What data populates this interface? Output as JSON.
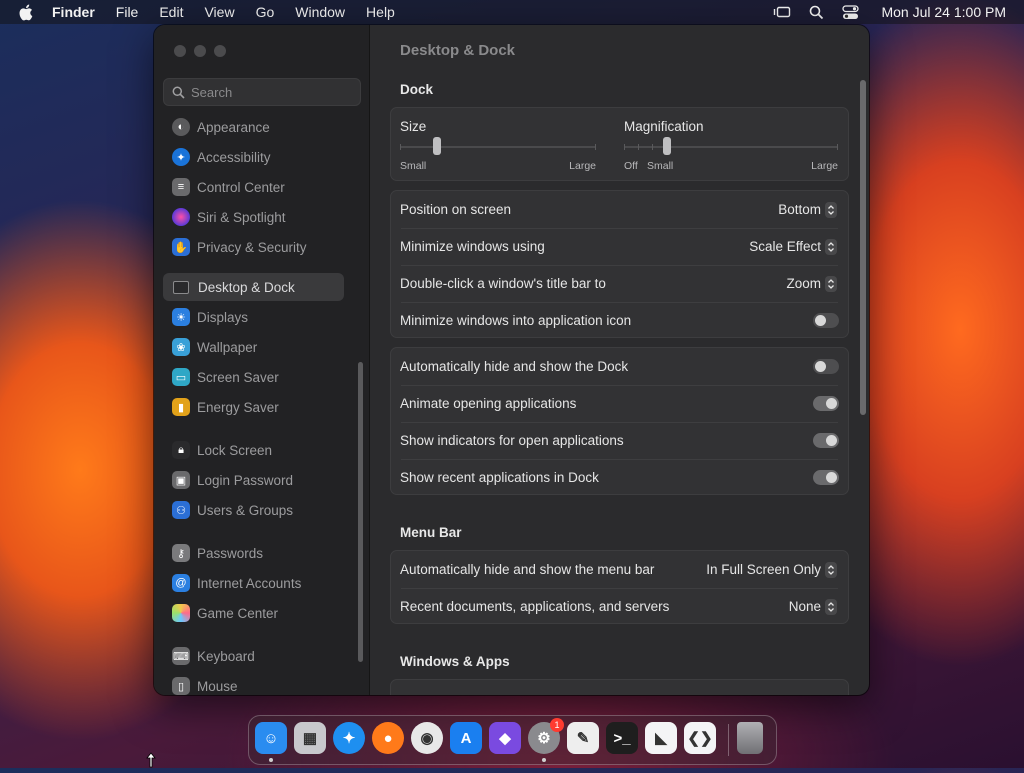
{
  "menubar": {
    "app_name": "Finder",
    "items": [
      "File",
      "Edit",
      "View",
      "Go",
      "Window",
      "Help"
    ],
    "clock": "Mon Jul 24  1:00 PM"
  },
  "sidebar": {
    "search_placeholder": "Search",
    "items": [
      {
        "label": "Appearance",
        "icon": "appearance-icon",
        "color": "#5a5a5c"
      },
      {
        "label": "Accessibility",
        "icon": "accessibility-icon",
        "color": "#1a73d9"
      },
      {
        "label": "Control Center",
        "icon": "control-center-icon",
        "color": "#6a6a6c"
      },
      {
        "label": "Siri & Spotlight",
        "icon": "siri-icon",
        "color": "#b03ad6"
      },
      {
        "label": "Privacy & Security",
        "icon": "hand-icon",
        "color": "#2b6fd6"
      },
      {
        "label": "Desktop & Dock",
        "icon": "dock-icon",
        "color": "#2a2a2c"
      },
      {
        "label": "Displays",
        "icon": "sun-icon",
        "color": "#2b7fe0"
      },
      {
        "label": "Wallpaper",
        "icon": "wallpaper-icon",
        "color": "#39a0d8"
      },
      {
        "label": "Screen Saver",
        "icon": "screen-saver-icon",
        "color": "#2fa7c6"
      },
      {
        "label": "Energy Saver",
        "icon": "battery-icon",
        "color": "#e2a21a"
      },
      {
        "label": "Lock Screen",
        "icon": "lock-icon",
        "color": "#2a2a2c"
      },
      {
        "label": "Login Password",
        "icon": "password-icon",
        "color": "#6a6a6c"
      },
      {
        "label": "Users & Groups",
        "icon": "users-icon",
        "color": "#2b6fd6"
      },
      {
        "label": "Passwords",
        "icon": "key-icon",
        "color": "#7a7a7c"
      },
      {
        "label": "Internet Accounts",
        "icon": "at-icon",
        "color": "#2b7fe0"
      },
      {
        "label": "Game Center",
        "icon": "game-center-icon",
        "color": "#c85aa0"
      },
      {
        "label": "Keyboard",
        "icon": "keyboard-icon",
        "color": "#6a6a6c"
      },
      {
        "label": "Mouse",
        "icon": "mouse-icon",
        "color": "#6a6a6c"
      }
    ]
  },
  "content": {
    "title": "Desktop & Dock",
    "dock_header": "Dock",
    "size": {
      "label": "Size",
      "min_label": "Small",
      "max_label": "Large",
      "value": 0.19
    },
    "magnification": {
      "label": "Magnification",
      "off_label": "Off",
      "min_label": "Small",
      "max_label": "Large",
      "value": 0.2
    },
    "dock_rows": [
      {
        "label": "Position on screen",
        "value": "Bottom"
      },
      {
        "label": "Minimize windows using",
        "value": "Scale Effect"
      },
      {
        "label": "Double-click a window's title bar to",
        "value": "Zoom"
      },
      {
        "label": "Minimize windows into application icon",
        "toggle": false
      }
    ],
    "dock_toggles": [
      {
        "label": "Automatically hide and show the Dock",
        "toggle": false
      },
      {
        "label": "Animate opening applications",
        "toggle": true
      },
      {
        "label": "Show indicators for open applications",
        "toggle": true
      },
      {
        "label": "Show recent applications in Dock",
        "toggle": true
      }
    ],
    "menubar_header": "Menu Bar",
    "menubar_rows": [
      {
        "label": "Automatically hide and show the menu bar",
        "value": "In Full Screen Only"
      },
      {
        "label": "Recent documents, applications, and servers",
        "value": "None"
      }
    ],
    "windows_header": "Windows & Apps"
  },
  "dock": {
    "apps": [
      {
        "name": "finder",
        "glyph": "☺",
        "color": "#2a8cf0",
        "running": true
      },
      {
        "name": "launchpad",
        "glyph": "▦",
        "color": "#c8c8cc"
      },
      {
        "name": "safari",
        "glyph": "✦",
        "color": "#1e8ff0"
      },
      {
        "name": "firefox",
        "glyph": "●",
        "color": "#ff7a1a"
      },
      {
        "name": "chrome",
        "glyph": "◉",
        "color": "#e8e8e8"
      },
      {
        "name": "app-store",
        "glyph": "A",
        "color": "#1a7ff0"
      },
      {
        "name": "xcode-simulator",
        "glyph": "◆",
        "color": "#7a4ae0"
      },
      {
        "name": "system-settings",
        "glyph": "⚙",
        "color": "#8a8a8e",
        "running": true,
        "badge": "1"
      },
      {
        "name": "textedit",
        "glyph": "✎",
        "color": "#eeeeee"
      },
      {
        "name": "terminal",
        "glyph": ">_",
        "color": "#1e1e1e"
      },
      {
        "name": "visual-studio",
        "glyph": "◣",
        "color": "#f4f4f6"
      },
      {
        "name": "vscode",
        "glyph": "❮❯",
        "color": "#f4f4f6"
      }
    ],
    "trash": {
      "name": "trash",
      "color": "#9a9a9e"
    }
  }
}
